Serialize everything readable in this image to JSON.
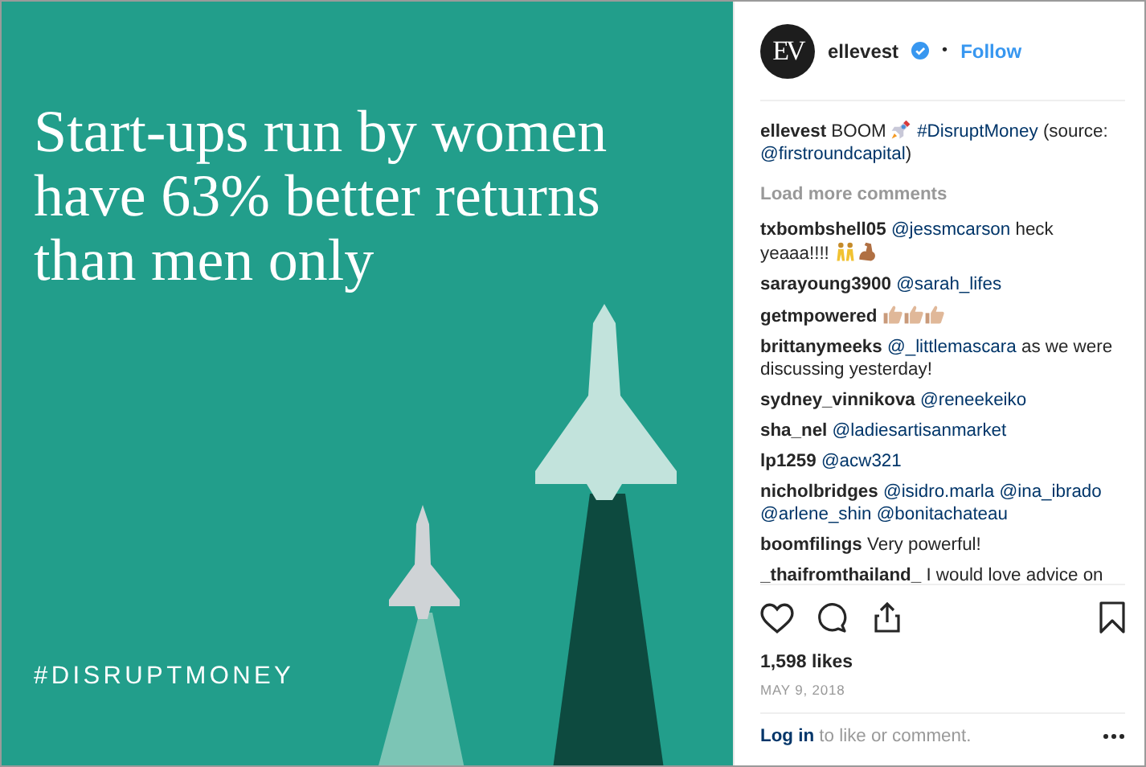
{
  "post_image": {
    "headline": "Start-ups run by women have 63% better returns than men only",
    "hashtag": "#DISRUPTMONEY"
  },
  "header": {
    "avatar_text": "EV",
    "username": "ellevest",
    "verified": true,
    "separator": "•",
    "follow": "Follow"
  },
  "caption": {
    "user": "ellevest",
    "parts": [
      {
        "kind": "text",
        "text": "BOOM"
      },
      {
        "kind": "rocket"
      },
      {
        "kind": "hashtag",
        "text": "#DisruptMoney"
      },
      {
        "kind": "text",
        "text": "(source:"
      },
      {
        "kind": "mention",
        "text": "@firstroundcapital"
      },
      {
        "kind": "text",
        "text": ")"
      }
    ]
  },
  "load_more": "Load more comments",
  "comments": [
    {
      "user": "txbombshell05",
      "parts": [
        {
          "kind": "mention",
          "text": "@jessmcarson"
        },
        {
          "kind": "text",
          "text": "heck yeaaa!!!!"
        },
        {
          "kind": "dancers"
        },
        {
          "kind": "muscle"
        }
      ]
    },
    {
      "user": "sarayoung3900",
      "parts": [
        {
          "kind": "mention",
          "text": "@sarah_lifes"
        }
      ]
    },
    {
      "user": "getmpowered",
      "parts": [
        {
          "kind": "thumbs"
        },
        {
          "kind": "thumbs"
        },
        {
          "kind": "thumbs"
        }
      ]
    },
    {
      "user": "brittanymeeks",
      "parts": [
        {
          "kind": "mention",
          "text": "@_littlemascara"
        },
        {
          "kind": "text",
          "text": "as we were discussing yesterday!"
        }
      ]
    },
    {
      "user": "sydney_vinnikova",
      "parts": [
        {
          "kind": "mention",
          "text": "@reneekeiko"
        }
      ]
    },
    {
      "user": "sha_nel",
      "parts": [
        {
          "kind": "mention",
          "text": "@ladiesartisanmarket"
        }
      ]
    },
    {
      "user": "lp1259",
      "parts": [
        {
          "kind": "mention",
          "text": "@acw321"
        }
      ]
    },
    {
      "user": "nicholbridges",
      "parts": [
        {
          "kind": "mention",
          "text": "@isidro.marla"
        },
        {
          "kind": "mention",
          "text": "@ina_ibrado"
        },
        {
          "kind": "mention",
          "text": "@arlene_shin"
        },
        {
          "kind": "mention",
          "text": "@bonitachateau"
        }
      ]
    },
    {
      "user": "boomfilings",
      "parts": [
        {
          "kind": "text",
          "text": "Very powerful!"
        }
      ]
    },
    {
      "user": "_thaifromthailand_",
      "parts": [
        {
          "kind": "text",
          "text": "I would love advice on"
        }
      ]
    }
  ],
  "actions": {
    "liked": false,
    "saved": false
  },
  "likes": "1,598 likes",
  "date": "MAY 9, 2018",
  "footer": {
    "login": "Log in",
    "rest": "to like or comment."
  }
}
